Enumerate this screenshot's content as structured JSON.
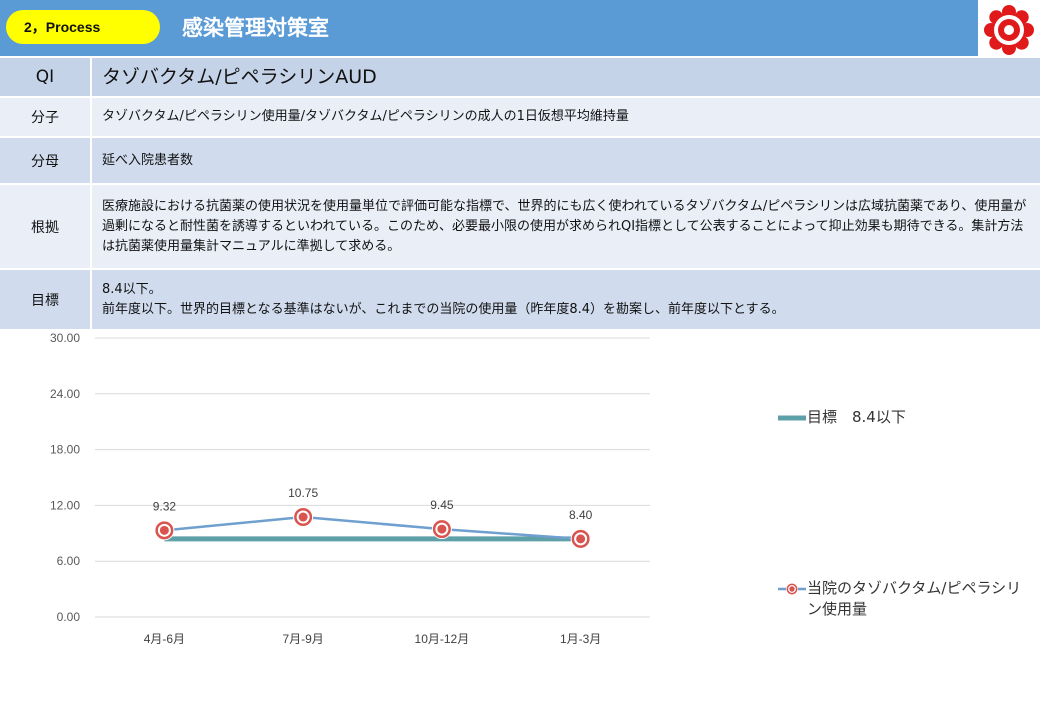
{
  "header": {
    "badge": "2，Process",
    "title": "感染管理対策室"
  },
  "table": {
    "qi_label": "QI",
    "qi_value": "タゾバクタム/ピペラシリンAUD",
    "rows": [
      {
        "label": "分子",
        "text": "タゾバクタム/ピペラシリン使用量/タゾバクタム/ピペラシリンの成人の1日仮想平均維持量"
      },
      {
        "label": "分母",
        "text": "延べ入院患者数"
      },
      {
        "label": "根拠",
        "text": "医療施設における抗菌薬の使用状況を使用量単位で評価可能な指標で、世界的にも広く使われているタゾバクタム/ピペラシリンは広域抗菌薬であり、使用量が過剰になると耐性菌を誘導するといわれている。このため、必要最小限の使用が求められQI指標として公表することによって抑止効果も期待できる。集計方法は抗菌薬使用量集計マニュアルに準拠して求める。"
      },
      {
        "label": "目標",
        "text_line1": "8.4以下。",
        "text_line2": "前年度以下。世界的目標となる基準はないが、これまでの当院の使用量（昨年度8.4）を勘案し、前年度以下とする。"
      }
    ]
  },
  "chart_data": {
    "type": "line",
    "categories": [
      "4月-6月",
      "7月-9月",
      "10月-12月",
      "1月-3月"
    ],
    "series": [
      {
        "name": "目標　8.4以下",
        "values": [
          8.4,
          8.4,
          8.4,
          8.4
        ],
        "color": "#5ea0a8"
      },
      {
        "name": "当院のタゾバクタム/ピペラシリン使用量",
        "values": [
          9.32,
          10.75,
          9.45,
          8.4
        ],
        "color": "#6f9fcf"
      }
    ],
    "data_labels": [
      "9.32",
      "10.75",
      "9.45",
      "8.40"
    ],
    "yticks": [
      "0.00",
      "6.00",
      "12.00",
      "18.00",
      "24.00",
      "30.00"
    ],
    "ylim": [
      0,
      30
    ],
    "grid": true,
    "legend": "right"
  }
}
